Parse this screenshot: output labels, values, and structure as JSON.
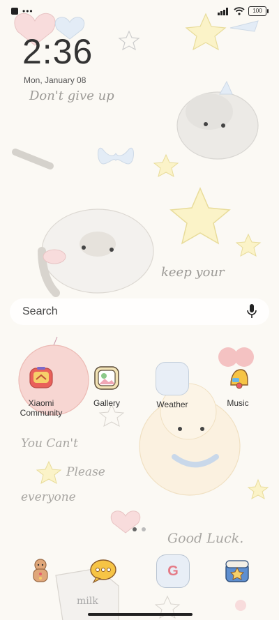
{
  "status_bar": {
    "battery": "100"
  },
  "lockscreen": {
    "time": "2:36",
    "date": "Mon, January 08"
  },
  "wallpaper_text": {
    "line1": "Don't give up",
    "line2": "keep your",
    "line3": "You Can't",
    "line4": "Please",
    "line5": "everyone",
    "line6": "Good Luck.",
    "milk": "milk"
  },
  "search": {
    "label": "Search"
  },
  "apps": [
    {
      "label": "Xiaomi Community",
      "icon": "xiaomi-community-icon"
    },
    {
      "label": "Gallery",
      "icon": "gallery-icon"
    },
    {
      "label": "Weather",
      "icon": "weather-icon"
    },
    {
      "label": "Music",
      "icon": "music-icon"
    }
  ],
  "dock": [
    {
      "icon": "gingerbread-icon"
    },
    {
      "icon": "messages-icon"
    },
    {
      "icon": "google-icon",
      "letter": "G"
    },
    {
      "icon": "store-icon"
    }
  ],
  "pages": {
    "count": 2,
    "active": 1
  }
}
